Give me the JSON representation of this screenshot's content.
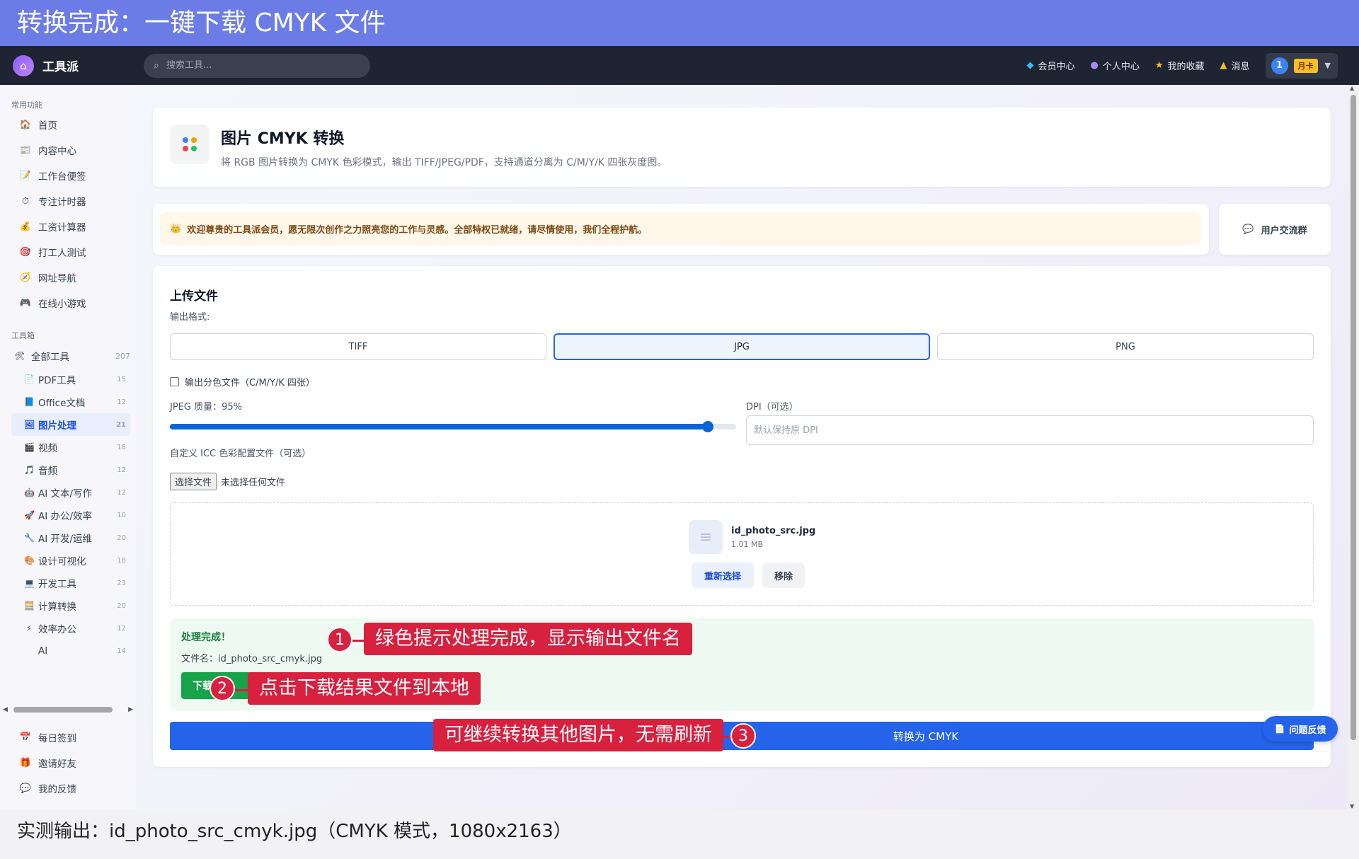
{
  "banner": {
    "title": "转换完成：一键下载 CMYK 文件"
  },
  "header": {
    "logo_text": "工具派",
    "logo_icon": "toolbox-icon",
    "search_placeholder": "搜索工具...",
    "nav": [
      {
        "icon": "diamond-icon",
        "label": "会员中心"
      },
      {
        "icon": "user-icon",
        "label": "个人中心"
      },
      {
        "icon": "star-icon",
        "label": "我的收藏"
      },
      {
        "icon": "bell-icon",
        "label": "消息"
      }
    ],
    "avatar_text": "1",
    "card_badge": "月卡"
  },
  "sidebar": {
    "common_title": "常用功能",
    "common_items": [
      {
        "icon": "🏠",
        "label": "首页"
      },
      {
        "icon": "📰",
        "label": "内容中心"
      },
      {
        "icon": "📝",
        "label": "工作台便签"
      },
      {
        "icon": "⏱",
        "label": "专注计时器"
      },
      {
        "icon": "💰",
        "label": "工资计算器"
      },
      {
        "icon": "🎯",
        "label": "打工人测试"
      },
      {
        "icon": "🧭",
        "label": "网址导航"
      },
      {
        "icon": "🎮",
        "label": "在线小游戏"
      }
    ],
    "toolbox_title": "工具箱",
    "all_tools": {
      "icon": "🛠",
      "label": "全部工具",
      "count": "207"
    },
    "categories": [
      {
        "icon": "📄",
        "label": "PDF工具",
        "count": "15"
      },
      {
        "icon": "📘",
        "label": "Office文档",
        "count": "12"
      },
      {
        "icon": "🖼",
        "label": "图片处理",
        "count": "21",
        "active": true
      },
      {
        "icon": "🎬",
        "label": "视频",
        "count": "18"
      },
      {
        "icon": "🎵",
        "label": "音频",
        "count": "12"
      },
      {
        "icon": "🤖",
        "label": "AI 文本/写作",
        "count": "12"
      },
      {
        "icon": "🚀",
        "label": "AI 办公/效率",
        "count": "10"
      },
      {
        "icon": "🔧",
        "label": "AI 开发/运维",
        "count": "20"
      },
      {
        "icon": "🎨",
        "label": "设计可视化",
        "count": "18"
      },
      {
        "icon": "💻",
        "label": "开发工具",
        "count": "23"
      },
      {
        "icon": "🧮",
        "label": "计算转换",
        "count": "20"
      },
      {
        "icon": "⚡",
        "label": "效率办公",
        "count": "12"
      },
      {
        "icon": "",
        "label": "AI",
        "count": "14"
      }
    ],
    "bottom_items": [
      {
        "icon": "📅",
        "label": "每日签到"
      },
      {
        "icon": "🎁",
        "label": "邀请好友"
      },
      {
        "icon": "💬",
        "label": "我的反馈"
      }
    ]
  },
  "hero": {
    "title": "图片 CMYK 转换",
    "desc": "将 RGB 图片转换为 CMYK 色彩模式，输出 TIFF/JPEG/PDF，支持通道分离为 C/M/Y/K 四张灰度图。",
    "icon_colors": [
      "#3b82f6",
      "#f59e0b",
      "#ef4444",
      "#22c55e"
    ]
  },
  "welcome": {
    "icon": "👑",
    "text": "欢迎尊贵的工具派会员，愿无限次创作之力照亮您的工作与灵感。全部特权已就绪，请尽情使用，我们全程护航。",
    "group_icon": "💬",
    "group_label": "用户交流群"
  },
  "form": {
    "section_title": "上传文件",
    "format_label": "输出格式:",
    "formats": [
      "TIFF",
      "JPG",
      "PNG"
    ],
    "selected_format": "JPG",
    "split_label": "输出分色文件（C/M/Y/K 四张）",
    "split_checked": false,
    "quality_label": "JPEG 质量：95%",
    "quality_value": 95,
    "quality_min": 1,
    "quality_max": 100,
    "dpi_label": "DPI（可选）",
    "dpi_placeholder": "默认保持原 DPI",
    "icc_label": "自定义 ICC 色彩配置文件（可选）",
    "choose_file": "选择文件",
    "no_file": "未选择任何文件",
    "file_name": "id_photo_src.jpg",
    "file_size": "1.01 MB",
    "reselect": "重新选择",
    "remove": "移除",
    "success_title": "处理完成！",
    "output_file": "文件名：id_photo_src_cmyk.jpg",
    "download_label": "下载",
    "convert_label": "转换为 CMYK"
  },
  "feedback": {
    "icon": "📄",
    "label": "问题反馈"
  },
  "callouts": [
    {
      "num": "1",
      "text": "绿色提示处理完成，显示输出文件名"
    },
    {
      "num": "2",
      "text": "点击下载结果文件到本地"
    },
    {
      "num": "3",
      "text": "可继续转换其他图片，无需刷新"
    }
  ],
  "caption": "实测输出：id_photo_src_cmyk.jpg（CMYK 模式，1080x2163）",
  "colors": {
    "banner": "#6c7ce7",
    "header": "#1e2432",
    "accent": "#2563eb",
    "success": "#16a34a",
    "callout": "#d8203f"
  }
}
